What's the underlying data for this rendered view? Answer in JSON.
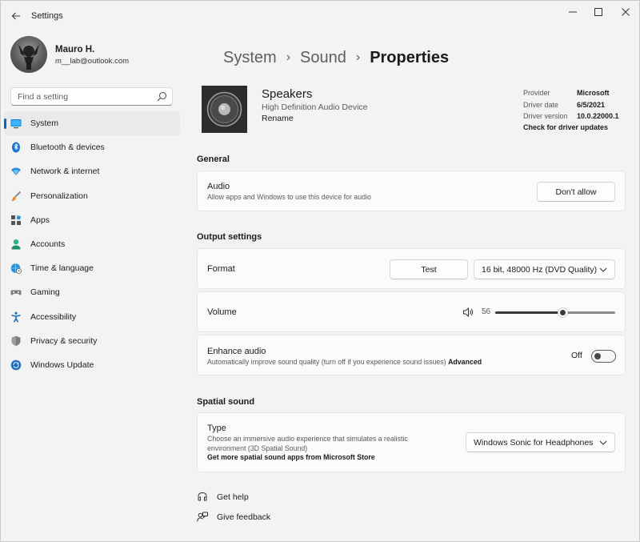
{
  "window": {
    "title": "Settings",
    "back_icon": "back-arrow-icon",
    "controls": {
      "minimize": "─",
      "maximize": "☐",
      "close": "✕"
    }
  },
  "profile": {
    "name": "Mauro H.",
    "email": "m__lab@outlook.com"
  },
  "search": {
    "placeholder": "Find a setting",
    "icon": "search-icon"
  },
  "sidebar": {
    "items": [
      {
        "label": "System",
        "icon": "system-icon",
        "active": true
      },
      {
        "label": "Bluetooth & devices",
        "icon": "bluetooth-icon"
      },
      {
        "label": "Network & internet",
        "icon": "wifi-icon"
      },
      {
        "label": "Personalization",
        "icon": "brush-icon"
      },
      {
        "label": "Apps",
        "icon": "apps-icon"
      },
      {
        "label": "Accounts",
        "icon": "person-icon"
      },
      {
        "label": "Time & language",
        "icon": "globe-clock-icon"
      },
      {
        "label": "Gaming",
        "icon": "gamepad-icon"
      },
      {
        "label": "Accessibility",
        "icon": "accessibility-icon"
      },
      {
        "label": "Privacy & security",
        "icon": "shield-icon"
      },
      {
        "label": "Windows Update",
        "icon": "update-icon"
      }
    ]
  },
  "breadcrumb": {
    "items": [
      "System",
      "Sound",
      "Properties"
    ],
    "separator": "›"
  },
  "device": {
    "name": "Speakers",
    "description": "High Definition Audio Device",
    "rename_label": "Rename",
    "icon": "speaker-icon"
  },
  "driver": {
    "rows": [
      {
        "key": "Provider",
        "value": "Microsoft"
      },
      {
        "key": "Driver date",
        "value": "6/5/2021"
      },
      {
        "key": "Driver version",
        "value": "10.0.22000.1"
      }
    ],
    "update_link": "Check for driver updates"
  },
  "general": {
    "title": "General",
    "audio": {
      "title": "Audio",
      "description": "Allow apps and Windows to use this device for audio",
      "button": "Don't allow"
    }
  },
  "output": {
    "title": "Output settings",
    "format": {
      "title": "Format",
      "test_button": "Test",
      "selected": "16 bit, 48000 Hz (DVD Quality)"
    },
    "volume": {
      "title": "Volume",
      "value": "56",
      "level": 0.56
    },
    "enhance": {
      "title": "Enhance audio",
      "description": "Automatically improve sound quality (turn off if you experience sound issues)",
      "advanced_link": "Advanced",
      "toggle_label": "Off",
      "on": false
    }
  },
  "spatial": {
    "title": "Spatial sound",
    "type": {
      "title": "Type",
      "description_line1": "Choose an immersive audio experience that simulates a realistic",
      "description_line2": "environment (3D Spatial Sound)",
      "store_link": "Get more spatial sound apps from Microsoft Store",
      "selected": "Windows Sonic for Headphones"
    }
  },
  "footer": {
    "help": "Get help",
    "feedback": "Give feedback"
  },
  "colors": {
    "accent": "#0067c0",
    "background": "#f3f3f3",
    "card": "#fbfbfb"
  }
}
